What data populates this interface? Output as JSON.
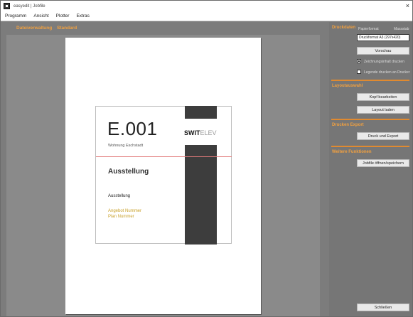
{
  "window": {
    "title": "easyedit | Jobfile",
    "close_glyph": "×"
  },
  "menu": {
    "items": [
      "Programm",
      "Ansicht",
      "Plotter",
      "Extras"
    ]
  },
  "doc_tabs": [
    "Dateiverwaltung",
    "Standard"
  ],
  "drawing": {
    "ref": "E.001",
    "brand_bold": "SWIT",
    "brand_thin": "ELEV",
    "subtitle": "Wohnung Eschstadt",
    "heading": "Ausstellung",
    "label1": "Ausstellung",
    "yellow_lines": [
      "Angebot Nummer",
      "Plan Nummer"
    ]
  },
  "panel": {
    "druckdaten": {
      "title": "Druckdaten",
      "col_a": "Papierformat",
      "col_b": "Massstab",
      "input_value": "Druckformat A3 (297x420)",
      "button": "Vorschau",
      "opt1": "Zeichnungsinhalt drucken",
      "opt2": "Legende drucken an Drucker"
    },
    "layout": {
      "title": "Layoutauswahl",
      "button1": "Kopf bearbeiten",
      "button2": "Layout laden"
    },
    "drucken": {
      "title": "Drucken Export",
      "button": "Druck und Export"
    },
    "weitere": {
      "title": "Weitere Funktionen",
      "button": "Jobfile öffnen/speichern"
    },
    "bottom_button": "Schließen"
  }
}
